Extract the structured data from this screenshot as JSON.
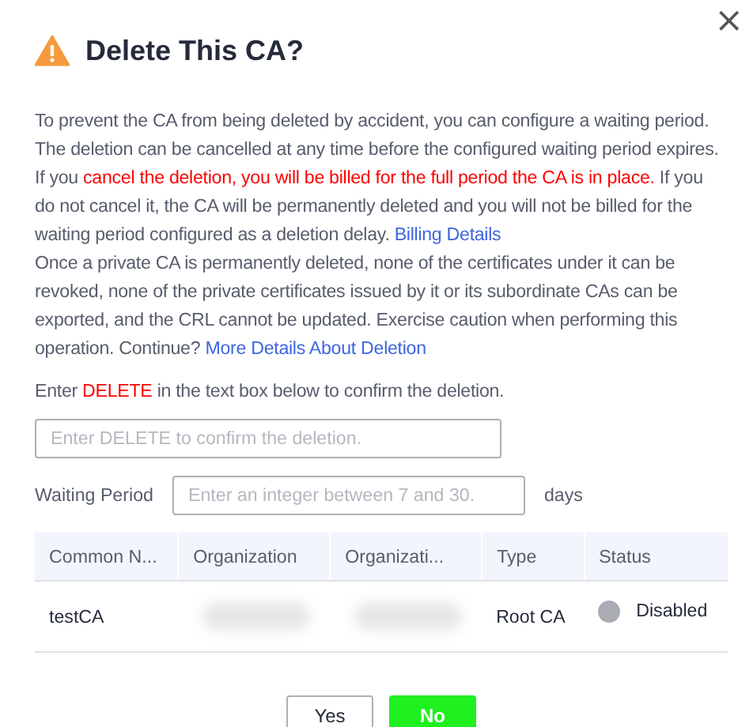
{
  "dialog": {
    "title": "Delete This CA?",
    "close": "×"
  },
  "paragraphs": [
    [
      {
        "kind": "plain",
        "text": "To prevent the CA from being deleted by accident, you can configure a waiting period. The deletion can be cancelled at any time before the configured waiting period expires. If you "
      },
      {
        "kind": "warning",
        "text": "cancel the deletion, you will be billed for the full period the CA is in place."
      },
      {
        "kind": "plain",
        "text": " If you do not cancel it, the CA will be permanently deleted and you will not be billed for the waiting period configured as a deletion delay. "
      },
      {
        "kind": "link",
        "text": "Billing Details"
      }
    ],
    [
      {
        "kind": "plain",
        "text": "Once a private CA is permanently deleted, none of the certificates under it can be revoked, none of the private certificates issued by it or its subordinate CAs can be exported, and the CRL cannot be updated. Exercise caution when performing this operation. Continue? "
      },
      {
        "kind": "link",
        "text": "More Details About Deletion"
      }
    ]
  ],
  "confirm_prompt": [
    {
      "kind": "plain",
      "text": "Enter "
    },
    {
      "kind": "warning",
      "text": "DELETE"
    },
    {
      "kind": "plain",
      "text": " in the text box below to confirm the deletion."
    }
  ],
  "confirm_field": {
    "placeholder": "Enter DELETE to confirm the deletion."
  },
  "waiting_period": {
    "label": "Waiting Period",
    "placeholder": "Enter an integer between 7 and 30.",
    "unit": "days"
  },
  "table": {
    "columns": [
      "Common N...",
      "Organization",
      "Organizati...",
      "Type",
      "Status"
    ],
    "rows": [
      {
        "cells": [
          {
            "kind": "text",
            "text": "testCA"
          },
          {
            "kind": "redacted"
          },
          {
            "kind": "redacted"
          },
          {
            "kind": "text",
            "text": "Root CA"
          },
          {
            "kind": "status",
            "text": "Disabled",
            "color": "#a9acb3"
          }
        ]
      }
    ]
  },
  "buttons": [
    {
      "label": "Yes",
      "primary": false
    },
    {
      "label": "No",
      "primary": true
    }
  ]
}
